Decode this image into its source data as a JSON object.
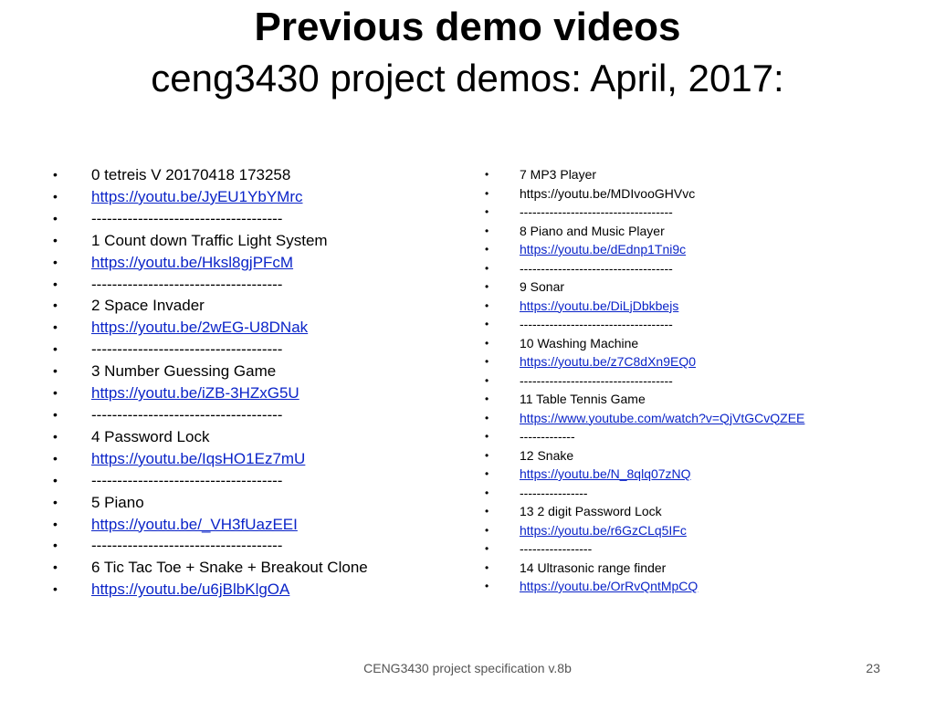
{
  "title": {
    "line1": "Previous demo videos",
    "line2": "ceng3430 project demos: April, 2017:"
  },
  "bullet_glyph": "•",
  "left_items": [
    {
      "text": "0  tetreis V 20170418 173258",
      "link": false
    },
    {
      "text": "https://youtu.be/JyEU1YbYMrc",
      "link": true
    },
    {
      "text": "-------------------------------------",
      "link": false
    },
    {
      "text": "1  Count down Traffic Light System",
      "link": false
    },
    {
      "text": "https://youtu.be/Hksl8gjPFcM",
      "link": true
    },
    {
      "text": "-------------------------------------",
      "link": false
    },
    {
      "text": "2  Space Invader",
      "link": false
    },
    {
      "text": "https://youtu.be/2wEG-U8DNak",
      "link": true
    },
    {
      "text": "-------------------------------------",
      "link": false
    },
    {
      "text": "3  Number Guessing Game",
      "link": false
    },
    {
      "text": "https://youtu.be/iZB-3HZxG5U",
      "link": true
    },
    {
      "text": "-------------------------------------",
      "link": false
    },
    {
      "text": "4  Password Lock",
      "link": false
    },
    {
      "text": "https://youtu.be/IqsHO1Ez7mU",
      "link": true
    },
    {
      "text": "-------------------------------------",
      "link": false
    },
    {
      "text": "5  Piano",
      "link": false
    },
    {
      "text": "https://youtu.be/_VH3fUazEEI",
      "link": true
    },
    {
      "text": "-------------------------------------",
      "link": false
    },
    {
      "text": "6 Tic Tac Toe + Snake + Breakout Clone",
      "link": false
    },
    {
      "text": "https://youtu.be/u6jBlbKlgOA",
      "link": true
    }
  ],
  "right_items": [
    {
      "text": "7  MP3 Player",
      "link": false
    },
    {
      "text": "https://youtu.be/MDIvooGHVvc",
      "link": false
    },
    {
      "text": "------------------------------------",
      "link": false
    },
    {
      "text": "8  Piano and Music Player",
      "link": false
    },
    {
      "text": "https://youtu.be/dEdnp1Tni9c",
      "link": true
    },
    {
      "text": "------------------------------------",
      "link": false
    },
    {
      "text": "9  Sonar",
      "link": false
    },
    {
      "text": "https://youtu.be/DiLjDbkbejs",
      "link": true
    },
    {
      "text": "------------------------------------",
      "link": false
    },
    {
      "text": "10  Washing Machine",
      "link": false
    },
    {
      "text": "https://youtu.be/z7C8dXn9EQ0",
      "link": true
    },
    {
      "text": "------------------------------------",
      "link": false
    },
    {
      "text": "11  Table Tennis Game",
      "link": false
    },
    {
      "text": "https://www.youtube.com/watch?v=QjVtGCvQZEE",
      "link": true
    },
    {
      "text": "-------------",
      "link": false
    },
    {
      "text": "12  Snake",
      "link": false
    },
    {
      "text": "https://youtu.be/N_8qlq07zNQ",
      "link": true
    },
    {
      "text": "----------------",
      "link": false
    },
    {
      "text": "13  2 digit Password Lock",
      "link": false
    },
    {
      "text": "https://youtu.be/r6GzCLq5IFc",
      "link": true
    },
    {
      "text": "-----------------",
      "link": false
    },
    {
      "text": "14  Ultrasonic range finder",
      "link": false
    },
    {
      "text": "https://youtu.be/OrRvQntMpCQ",
      "link": true
    }
  ],
  "footer": {
    "text": "CENG3430 project specification v.8b",
    "page_number": "23"
  },
  "colors": {
    "link": "#0b24c8",
    "text": "#000000",
    "footer": "#555555",
    "background": "#ffffff"
  }
}
